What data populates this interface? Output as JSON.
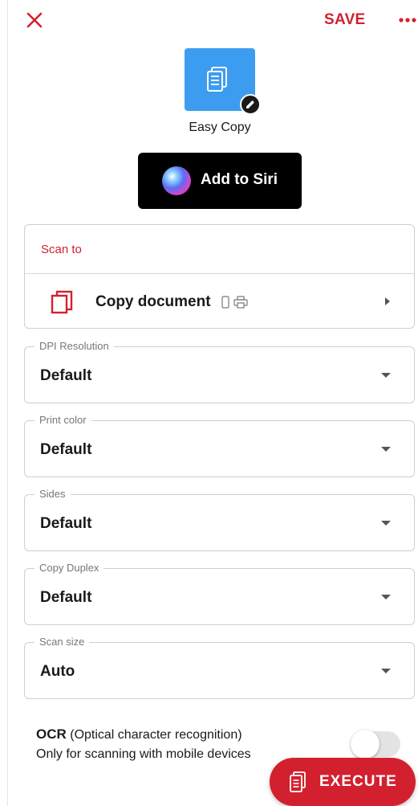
{
  "header": {
    "close_icon": "close-icon",
    "save_label": "SAVE",
    "more_icon": "more-horizontal-icon",
    "accent_color": "#d3202f"
  },
  "shortcut": {
    "icon": "document-copy-icon",
    "tile_color": "#3c9cf0",
    "edit_icon": "pencil-icon",
    "name": "Easy Copy"
  },
  "siri": {
    "label": "Add to Siri",
    "icon": "siri-icon"
  },
  "scan_to": {
    "title": "Scan to",
    "item_label": "Copy document",
    "item_icon": "copy-document-icon",
    "device_icons": [
      "phone-icon",
      "printer-icon"
    ]
  },
  "fields": [
    {
      "label": "DPI Resolution",
      "value": "Default"
    },
    {
      "label": "Print color",
      "value": "Default"
    },
    {
      "label": "Sides",
      "value": "Default"
    },
    {
      "label": "Copy Duplex",
      "value": "Default"
    },
    {
      "label": "Scan size",
      "value": "Auto"
    }
  ],
  "ocr": {
    "title": "OCR",
    "title_suffix": "(Optical character recognition)",
    "subtitle": "Only for scanning with mobile devices",
    "enabled": false
  },
  "execute": {
    "label": "EXECUTE",
    "icon": "document-icon"
  }
}
